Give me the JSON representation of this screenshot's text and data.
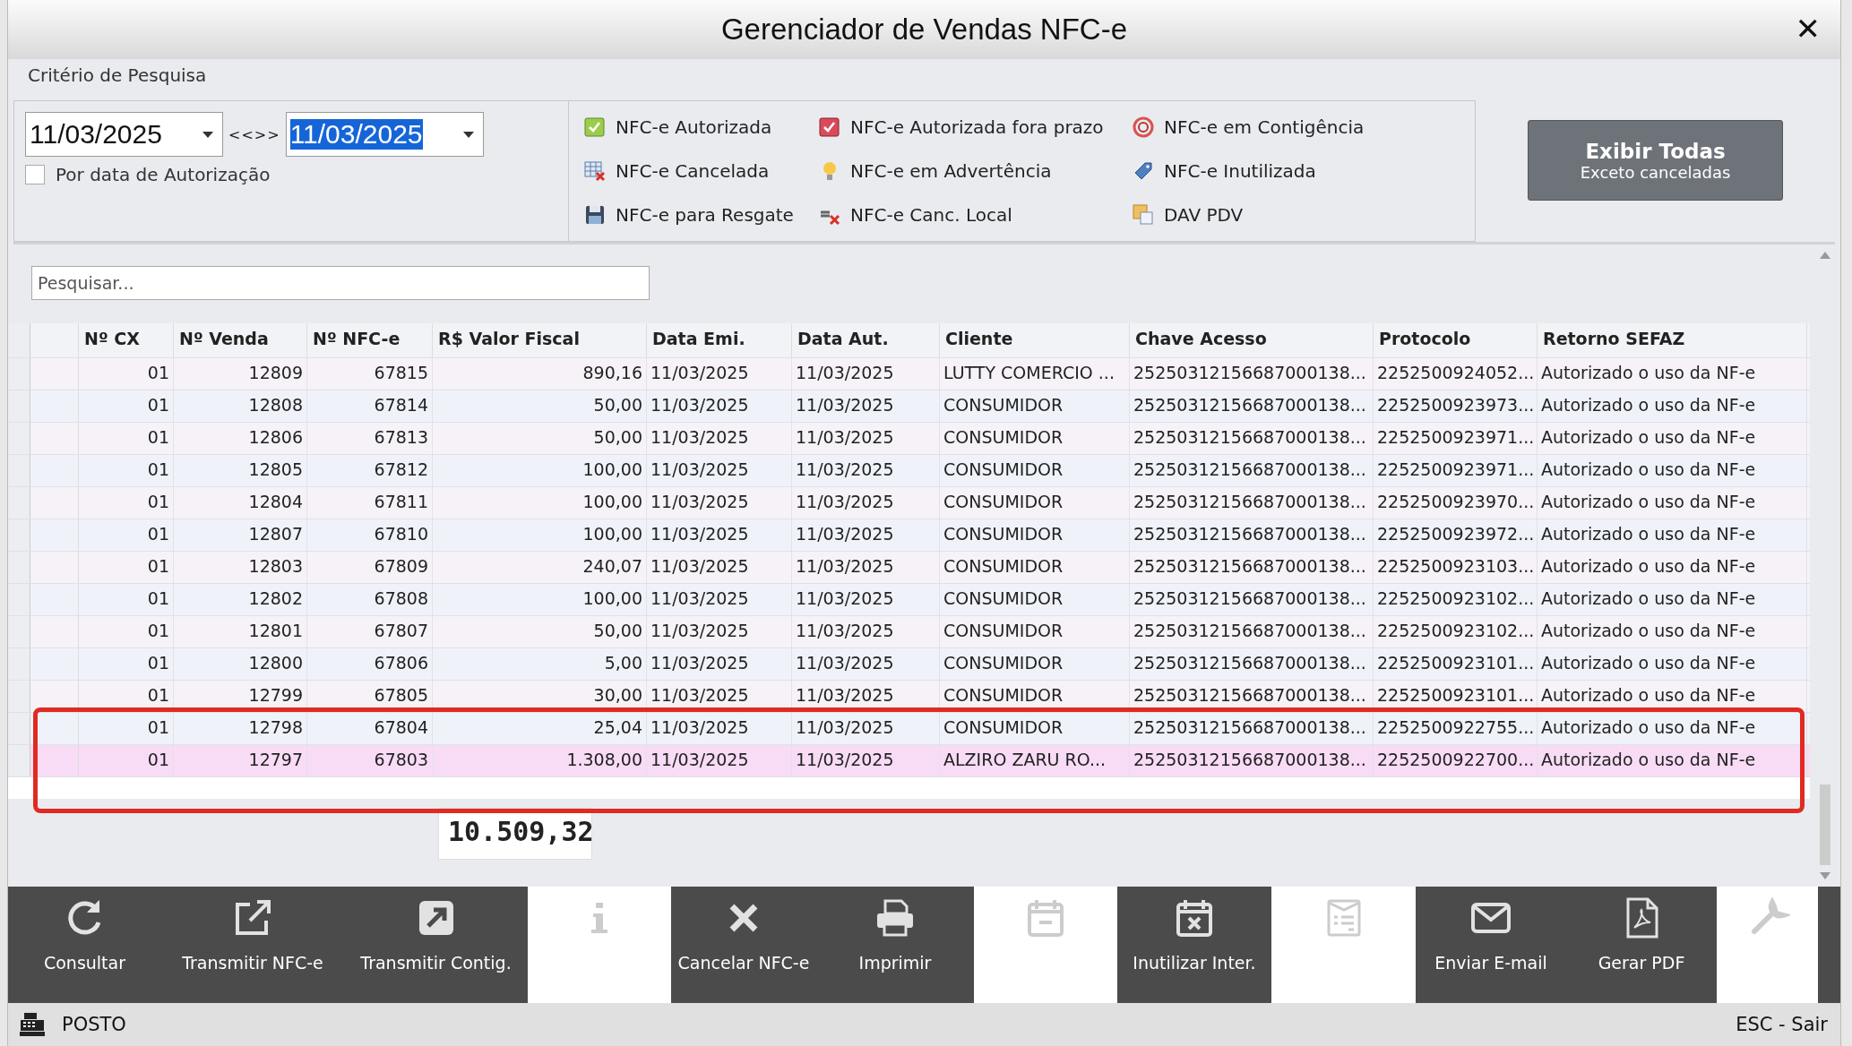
{
  "window": {
    "title": "Gerenciador de Vendas NFC-e",
    "close": "✕"
  },
  "criteria": {
    "title": "Critério de Pesquisa",
    "date_from": {
      "value": "11/03/2025",
      "text_selected": false
    },
    "range_sep": "<<>>",
    "date_to": {
      "value": "11/03/2025",
      "text_selected": true
    },
    "by_authorization": {
      "label": "Por data de Autorização",
      "checked": false
    }
  },
  "legend": [
    {
      "label": "NFC-e Autorizada"
    },
    {
      "label": "NFC-e Autorizada fora prazo"
    },
    {
      "label": "NFC-e em Contigência"
    },
    {
      "label": "NFC-e Cancelada"
    },
    {
      "label": "NFC-e em Advertência"
    },
    {
      "label": "NFC-e Inutilizada"
    },
    {
      "label": "NFC-e para Resgate"
    },
    {
      "label": "NFC-e Canc. Local"
    },
    {
      "label": "DAV PDV"
    }
  ],
  "show_all": {
    "title": "Exibir Todas",
    "subtitle": "Exceto canceladas"
  },
  "search": {
    "placeholder": "Pesquisar..."
  },
  "table": {
    "columns": [
      "Nº CX",
      "Nº Venda",
      "Nº NFC-e",
      "R$ Valor Fiscal",
      "Data Emi.",
      "Data Aut.",
      "Cliente",
      "Chave Acesso",
      "Protocolo",
      "Retorno SEFAZ"
    ],
    "rows": [
      {
        "cells": [
          "01",
          "12809",
          "67815",
          "890,16",
          "11/03/2025",
          "11/03/2025",
          "LUTTY COMERCIO ...",
          "25250312156687000138...",
          "2252500924052...",
          "Autorizado o uso da NF-e"
        ],
        "selected": false,
        "highlighted": false
      },
      {
        "cells": [
          "01",
          "12808",
          "67814",
          "50,00",
          "11/03/2025",
          "11/03/2025",
          "CONSUMIDOR",
          "25250312156687000138...",
          "2252500923973...",
          "Autorizado o uso da NF-e"
        ],
        "selected": false,
        "highlighted": false
      },
      {
        "cells": [
          "01",
          "12806",
          "67813",
          "50,00",
          "11/03/2025",
          "11/03/2025",
          "CONSUMIDOR",
          "25250312156687000138...",
          "2252500923971...",
          "Autorizado o uso da NF-e"
        ],
        "selected": false,
        "highlighted": false
      },
      {
        "cells": [
          "01",
          "12805",
          "67812",
          "100,00",
          "11/03/2025",
          "11/03/2025",
          "CONSUMIDOR",
          "25250312156687000138...",
          "2252500923971...",
          "Autorizado o uso da NF-e"
        ],
        "selected": false,
        "highlighted": false
      },
      {
        "cells": [
          "01",
          "12804",
          "67811",
          "100,00",
          "11/03/2025",
          "11/03/2025",
          "CONSUMIDOR",
          "25250312156687000138...",
          "2252500923970...",
          "Autorizado o uso da NF-e"
        ],
        "selected": false,
        "highlighted": false
      },
      {
        "cells": [
          "01",
          "12807",
          "67810",
          "100,00",
          "11/03/2025",
          "11/03/2025",
          "CONSUMIDOR",
          "25250312156687000138...",
          "2252500923972...",
          "Autorizado o uso da NF-e"
        ],
        "selected": false,
        "highlighted": false
      },
      {
        "cells": [
          "01",
          "12803",
          "67809",
          "240,07",
          "11/03/2025",
          "11/03/2025",
          "CONSUMIDOR",
          "25250312156687000138...",
          "2252500923103...",
          "Autorizado o uso da NF-e"
        ],
        "selected": false,
        "highlighted": false
      },
      {
        "cells": [
          "01",
          "12802",
          "67808",
          "100,00",
          "11/03/2025",
          "11/03/2025",
          "CONSUMIDOR",
          "25250312156687000138...",
          "2252500923102...",
          "Autorizado o uso da NF-e"
        ],
        "selected": false,
        "highlighted": false
      },
      {
        "cells": [
          "01",
          "12801",
          "67807",
          "50,00",
          "11/03/2025",
          "11/03/2025",
          "CONSUMIDOR",
          "25250312156687000138...",
          "2252500923102...",
          "Autorizado o uso da NF-e"
        ],
        "selected": false,
        "highlighted": false
      },
      {
        "cells": [
          "01",
          "12800",
          "67806",
          "5,00",
          "11/03/2025",
          "11/03/2025",
          "CONSUMIDOR",
          "25250312156687000138...",
          "2252500923101...",
          "Autorizado o uso da NF-e"
        ],
        "selected": false,
        "highlighted": false
      },
      {
        "cells": [
          "01",
          "12799",
          "67805",
          "30,00",
          "11/03/2025",
          "11/03/2025",
          "CONSUMIDOR",
          "25250312156687000138...",
          "2252500923101...",
          "Autorizado o uso da NF-e"
        ],
        "selected": false,
        "highlighted": false
      },
      {
        "cells": [
          "01",
          "12798",
          "67804",
          "25,04",
          "11/03/2025",
          "11/03/2025",
          "CONSUMIDOR",
          "25250312156687000138...",
          "2252500922755...",
          "Autorizado o uso da NF-e"
        ],
        "selected": false,
        "highlighted": true
      },
      {
        "cells": [
          "01",
          "12797",
          "67803",
          "1.308,00",
          "11/03/2025",
          "11/03/2025",
          "ALZIRO ZARU RO...",
          "25250312156687000138...",
          "2252500922700...",
          "Autorizado o uso da NF-e"
        ],
        "selected": true,
        "highlighted": true
      }
    ],
    "total": "10.509,32"
  },
  "toolbar": [
    {
      "label": "Consultar",
      "disabled": false
    },
    {
      "label": "Transmitir NFC-e",
      "disabled": false
    },
    {
      "label": "Transmitir Contig.",
      "disabled": false
    },
    {
      "disabled": true
    },
    {
      "label": "Cancelar NFC-e",
      "disabled": false
    },
    {
      "label": "Imprimir",
      "disabled": false
    },
    {
      "disabled": true
    },
    {
      "label": "Inutilizar Inter.",
      "disabled": false
    },
    {
      "disabled": true
    },
    {
      "label": "Enviar E-mail",
      "disabled": false
    },
    {
      "label": "Gerar PDF",
      "disabled": false
    },
    {
      "disabled": true
    }
  ],
  "status_bar": {
    "station": "POSTO",
    "hint": "ESC - Sair"
  }
}
